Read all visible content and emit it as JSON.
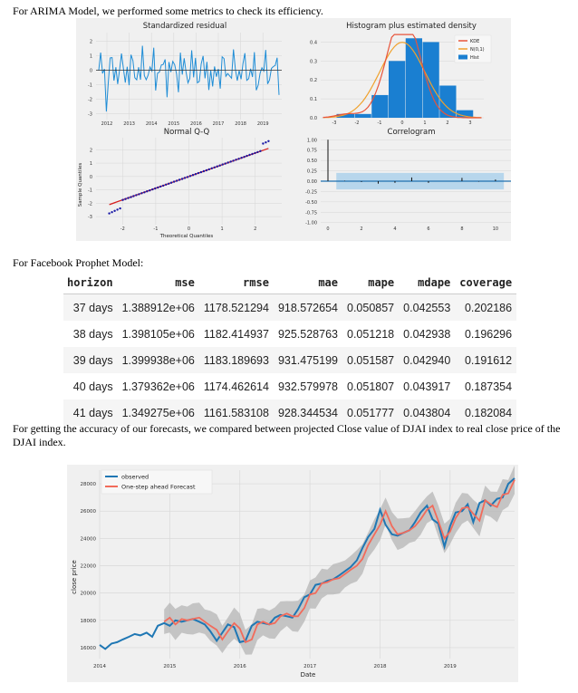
{
  "doc": {
    "intro_arima": "For ARIMA Model, we performed some metrics to check its efficiency.",
    "intro_prophet": "For Facebook Prophet Model:",
    "intro_forecast": "For getting the accuracy of our forecasts, we compared between projected Close value of DJAI index to real close price of the DJAI index."
  },
  "arima_diagnostics": {
    "panels": {
      "residual_title": "Standardized residual",
      "hist_title": "Histogram plus estimated density",
      "qq_title": "Normal Q-Q",
      "corr_title": "Correlogram",
      "qq_xlabel": "Theoretical Quantiles",
      "qq_ylabel": "Sample Quantiles"
    },
    "legend": [
      "KDE",
      "N(0,1)",
      "Hist"
    ],
    "colors": {
      "residual": "#1f8dd6",
      "kde": "#e8543a",
      "normal": "#f0a12c",
      "hist": "#1a7fd1",
      "qq_points": "#1a1aa6",
      "qq_line": "#d62020",
      "panel_bg": "#f0f0f0"
    },
    "residual_xticks": [
      "2012",
      "2013",
      "2014",
      "2015",
      "2016",
      "2017",
      "2018",
      "2019"
    ],
    "residual_yticks": [
      "2",
      "1",
      "0",
      "-1",
      "-2",
      "-3"
    ],
    "hist_xticks": [
      "-3",
      "-2",
      "-1",
      "0",
      "1",
      "2",
      "3"
    ],
    "hist_yticks": [
      "0.4",
      "0.3",
      "0.2",
      "0.1",
      "0.0"
    ],
    "qq_xticks": [
      "-2",
      "-1",
      "0",
      "1",
      "2"
    ],
    "qq_yticks": [
      "2",
      "1",
      "0",
      "-1",
      "-2",
      "-3"
    ],
    "corr_xticks": [
      "0",
      "2",
      "4",
      "6",
      "8",
      "10"
    ],
    "corr_yticks": [
      "1.00",
      "0.75",
      "0.50",
      "0.25",
      "0.00",
      "-0.25",
      "-0.50",
      "-0.75",
      "-1.00"
    ],
    "hist_bins": [
      0.02,
      0.02,
      0.12,
      0.3,
      0.42,
      0.4,
      0.17,
      0.04
    ],
    "hist_bin_edges": [
      -2.9,
      -2.1,
      -1.35,
      -0.6,
      0.15,
      0.9,
      1.65,
      2.4,
      3.15
    ],
    "correlogram_lags": [
      0,
      1,
      2,
      3,
      4,
      5,
      6,
      7,
      8,
      9,
      10
    ],
    "correlogram_values": [
      1.0,
      0.01,
      -0.02,
      -0.06,
      -0.04,
      0.09,
      -0.04,
      0.0,
      0.08,
      -0.01,
      0.04
    ]
  },
  "prophet_table": {
    "headers": [
      "horizon",
      "mse",
      "rmse",
      "mae",
      "mape",
      "mdape",
      "coverage"
    ],
    "rows": [
      [
        "37 days",
        "1.388912e+06",
        "1178.521294",
        "918.572654",
        "0.050857",
        "0.042553",
        "0.202186"
      ],
      [
        "38 days",
        "1.398105e+06",
        "1182.414937",
        "925.528763",
        "0.051218",
        "0.042938",
        "0.196296"
      ],
      [
        "39 days",
        "1.399938e+06",
        "1183.189693",
        "931.475199",
        "0.051587",
        "0.042940",
        "0.191612"
      ],
      [
        "40 days",
        "1.379362e+06",
        "1174.462614",
        "932.579978",
        "0.051807",
        "0.043917",
        "0.187354"
      ],
      [
        "41 days",
        "1.349275e+06",
        "1161.583108",
        "928.344534",
        "0.051777",
        "0.043804",
        "0.182084"
      ]
    ]
  },
  "chart_data": {
    "type": "line",
    "title": "",
    "xlabel": "Date",
    "ylabel": "close price",
    "x_ticks": [
      "2014",
      "2015",
      "2016",
      "2017",
      "2018",
      "2019"
    ],
    "y_ticks": [
      "16000",
      "18000",
      "20000",
      "22000",
      "24000",
      "26000",
      "28000"
    ],
    "ylim": [
      15200,
      29000
    ],
    "xlim": [
      2014.0,
      2019.92
    ],
    "legend_position": "top-left",
    "grid": true,
    "colors": {
      "observed": "#1f77b4",
      "forecast": "#f26b5b",
      "ci": "#b5b5b5",
      "bg": "#f0f0f0"
    },
    "series": [
      {
        "name": "observed",
        "x": [
          2014.0,
          2014.08,
          2014.17,
          2014.25,
          2014.33,
          2014.42,
          2014.5,
          2014.58,
          2014.67,
          2014.75,
          2014.83,
          2014.92,
          2015.0,
          2015.08,
          2015.17,
          2015.25,
          2015.33,
          2015.42,
          2015.5,
          2015.58,
          2015.67,
          2015.75,
          2015.83,
          2015.92,
          2016.0,
          2016.08,
          2016.17,
          2016.25,
          2016.33,
          2016.42,
          2016.5,
          2016.58,
          2016.67,
          2016.75,
          2016.83,
          2016.92,
          2017.0,
          2017.08,
          2017.17,
          2017.25,
          2017.33,
          2017.42,
          2017.5,
          2017.58,
          2017.67,
          2017.75,
          2017.83,
          2017.92,
          2018.0,
          2018.08,
          2018.17,
          2018.25,
          2018.33,
          2018.42,
          2018.5,
          2018.58,
          2018.67,
          2018.75,
          2018.83,
          2018.92,
          2019.0,
          2019.08,
          2019.17,
          2019.25,
          2019.33,
          2019.42,
          2019.5,
          2019.58,
          2019.67,
          2019.75,
          2019.83,
          2019.92
        ],
        "values": [
          16200,
          15900,
          16300,
          16400,
          16600,
          16800,
          17000,
          16900,
          17100,
          16800,
          17600,
          17800,
          17600,
          18000,
          17900,
          18000,
          18100,
          17900,
          17700,
          17200,
          16500,
          17100,
          17700,
          17500,
          16400,
          16500,
          17600,
          17900,
          17800,
          17700,
          18200,
          18400,
          18300,
          18200,
          18800,
          19700,
          19900,
          20600,
          20700,
          20900,
          21000,
          21300,
          21600,
          21900,
          22400,
          23300,
          24100,
          24700,
          26100,
          25000,
          24300,
          24200,
          24400,
          24600,
          25200,
          25900,
          26400,
          25400,
          25100,
          23400,
          24900,
          25900,
          26000,
          26500,
          25200,
          26600,
          26800,
          26400,
          26900,
          27000,
          28000,
          28400
        ]
      },
      {
        "name": "One-step ahead Forecast",
        "x": [
          2014.92,
          2015.0,
          2015.08,
          2015.17,
          2015.25,
          2015.33,
          2015.42,
          2015.5,
          2015.58,
          2015.67,
          2015.75,
          2015.83,
          2015.92,
          2016.0,
          2016.08,
          2016.17,
          2016.25,
          2016.33,
          2016.42,
          2016.5,
          2016.58,
          2016.67,
          2016.75,
          2016.83,
          2016.92,
          2017.0,
          2017.08,
          2017.17,
          2017.25,
          2017.33,
          2017.42,
          2017.5,
          2017.58,
          2017.67,
          2017.75,
          2017.83,
          2017.92,
          2018.0,
          2018.08,
          2018.17,
          2018.25,
          2018.33,
          2018.42,
          2018.5,
          2018.58,
          2018.67,
          2018.75,
          2018.83,
          2018.92,
          2019.0,
          2019.08,
          2019.17,
          2019.25,
          2019.33,
          2019.42,
          2019.5,
          2019.58,
          2019.67,
          2019.75,
          2019.83,
          2019.92
        ],
        "values": [
          17900,
          18200,
          17700,
          18100,
          18000,
          18100,
          18200,
          17900,
          17600,
          17300,
          16600,
          17200,
          17800,
          17400,
          16400,
          16600,
          17700,
          17900,
          17700,
          17800,
          18300,
          18500,
          18300,
          18300,
          18900,
          19900,
          20000,
          20700,
          20800,
          21000,
          21100,
          21400,
          21700,
          22000,
          22500,
          23500,
          24300,
          25000,
          26000,
          24900,
          24300,
          24400,
          24600,
          24900,
          25400,
          26100,
          26400,
          25300,
          24000,
          24500,
          25500,
          26200,
          26300,
          25800,
          25300,
          26800,
          26500,
          26300,
          27200,
          27300,
          28300
        ]
      }
    ]
  }
}
